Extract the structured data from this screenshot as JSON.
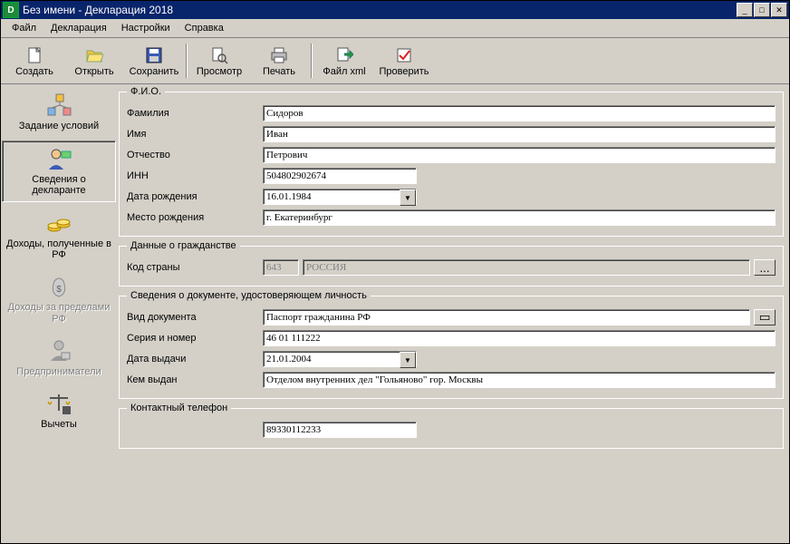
{
  "title": "Без имени - Декларация 2018",
  "menu": {
    "file": "Файл",
    "decl": "Декларация",
    "settings": "Настройки",
    "help": "Справка"
  },
  "toolbar": {
    "create": "Создать",
    "open": "Открыть",
    "save": "Сохранить",
    "preview": "Просмотр",
    "print": "Печать",
    "xml": "Файл xml",
    "check": "Проверить"
  },
  "sidebar": {
    "items": [
      {
        "label": "Задание условий"
      },
      {
        "label": "Сведения о декларанте"
      },
      {
        "label": "Доходы, полученные в РФ"
      },
      {
        "label": "Доходы за пределами РФ"
      },
      {
        "label": "Предприниматели"
      },
      {
        "label": "Вычеты"
      }
    ]
  },
  "form": {
    "fio": {
      "legend": "Ф.И.О.",
      "surname_label": "Фамилия",
      "surname": "Сидоров",
      "name_label": "Имя",
      "name": "Иван",
      "patronymic_label": "Отчество",
      "patronymic": "Петрович",
      "inn_label": "ИНН",
      "inn": "504802902674",
      "birthdate_label": "Дата рождения",
      "birthdate": "16.01.1984",
      "birthplace_label": "Место рождения",
      "birthplace": "г. Екатеринбург"
    },
    "citizenship": {
      "legend": "Данные о гражданстве",
      "country_code_label": "Код страны",
      "country_code": "643",
      "country_name": "РОССИЯ",
      "browse": "..."
    },
    "doc": {
      "legend": "Сведения о документе, удостоверяющем личность",
      "type_label": "Вид документа",
      "type": "Паспорт гражданина РФ",
      "series_label": "Серия и номер",
      "series": "46 01 111222",
      "issue_date_label": "Дата выдачи",
      "issue_date": "21.01.2004",
      "issued_by_label": "Кем выдан",
      "issued_by": "Отделом внутренних дел \"Гольяново\" гор. Москвы"
    },
    "contact": {
      "legend": "Контактный телефон",
      "phone": "89330112233"
    }
  }
}
